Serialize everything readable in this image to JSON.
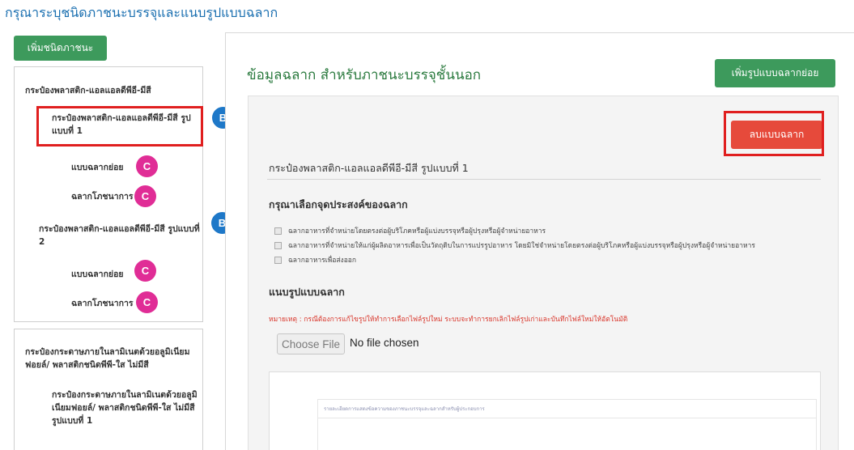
{
  "page": {
    "heading": "กรุณาระบุชนิดภาชนะบรรจุและแนบรูปแบบฉลาก"
  },
  "sidebar": {
    "add_container_label": "เพิ่มชนิดภาชนะ",
    "group1": {
      "title": "กระป๋องพลาสติก-แอลแอลดีพีอี-มีสี",
      "variant1": {
        "title": "กระป๋องพลาสติก-แอลแอลดีพีอี-มีสี รูปแบบที่ 1",
        "sublabel": "แบบฉลากย่อย",
        "nutrition": "ฉลากโภชนาการ"
      },
      "variant2": {
        "title": "กระป๋องพลาสติก-แอลแอลดีพีอี-มีสี รูปแบบที่ 2",
        "sublabel": "แบบฉลากย่อย",
        "nutrition": "ฉลากโภชนาการ"
      }
    },
    "group2": {
      "title": "กระป๋องกระดาษภายในลามิเนตด้วยอลูมิเนียมฟอยล์/ พลาสติกชนิดพีพี-ใส ไม่มีสี",
      "variant1": {
        "title": "กระป๋องกระดาษภายในลามิเนตด้วยอลูมิเนียมฟอยล์/ พลาสติกชนิดพีพี-ใส ไม่มีสี รูปแบบที่ 1"
      }
    }
  },
  "badges": {
    "b": "B",
    "c": "C"
  },
  "main": {
    "section_title": "ข้อมูลฉลาก สำหรับภาชนะบรรจุชั้นนอก",
    "add_sublabel_button": "เพิ่มรูปแบบฉลากย่อย",
    "delete_button": "ลบแบบฉลาก",
    "card_title": "กระป๋องพลาสติก-แอลแอลดีพีอี-มีสี  รูปแบบที่ 1",
    "purpose_heading": "กรุณาเลือกจุดประสงค์ของฉลาก",
    "purpose_options": [
      "ฉลากอาหารที่จำหน่ายโดยตรงต่อผู้บริโภคหรือผู้แบ่งบรรจุหรือผู้ปรุงหรือผู้จำหน่ายอาหาร",
      "ฉลากอาหารที่จำหน่ายให้แก่ผู้ผลิตอาหารเพื่อเป็นวัตถุดิบในการแปรรูปอาหาร โดยมิใช่จำหน่ายโดยตรงต่อผู้บริโภคหรือผู้แบ่งบรรจุหรือผู้ปรุงหรือผู้จำหน่ายอาหาร",
      "ฉลากอาหารเพื่อส่งออก"
    ],
    "attach_heading": "แนบรูปแบบฉลาก",
    "note": "หมายเหตุ : กรณีต้องการแก้ไขรูปให้ทำการเลือกไฟล์รูปใหม่ ระบบจะทำการยกเลิกไฟล์รูปเก่าและบันทึกไฟล์ใหม่ให้อัตโนมัติ",
    "file_button": "Choose File",
    "file_status": "No file chosen",
    "preview_text": "รายละเอียดการแสดงข้อความของภาชนะบรรจุและฉลากสำหรับผู้ประกอบการ"
  },
  "colors": {
    "link_blue": "#1a6fb0",
    "green": "#3d9a5c",
    "red": "#e64a3b",
    "badge_b": "#1e78c8",
    "badge_c": "#e02d96",
    "highlight": "#e01f1f"
  }
}
